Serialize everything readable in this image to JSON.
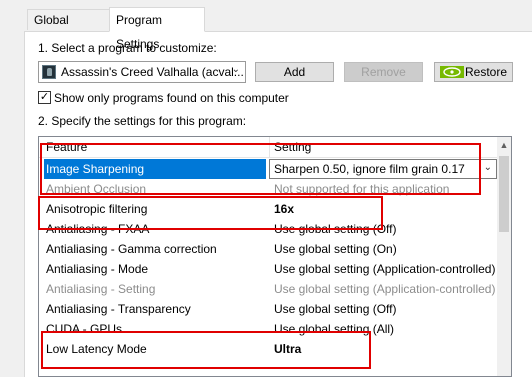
{
  "tabs": [
    {
      "label": "Global Settings"
    },
    {
      "label": "Program Settings"
    }
  ],
  "step1": {
    "label": "1. Select a program to customize:",
    "program_selected": "Assassin's Creed Valhalla (acval...",
    "add_label": "Add",
    "remove_label": "Remove",
    "restore_label": "Restore",
    "show_only_label": "Show only programs found on this computer",
    "show_only_checked": true
  },
  "step2": {
    "label": "2. Specify the settings for this program:",
    "headers": {
      "feature": "Feature",
      "setting": "Setting"
    },
    "rows": [
      {
        "feature": "Image Sharpening",
        "setting": "Sharpen 0.50, ignore film grain 0.17"
      },
      {
        "feature": "Ambient Occlusion",
        "setting": "Not supported for this application"
      },
      {
        "feature": "Anisotropic filtering",
        "setting": "16x"
      },
      {
        "feature": "Antialiasing - FXAA",
        "setting": "Use global setting (Off)"
      },
      {
        "feature": "Antialiasing - Gamma correction",
        "setting": "Use global setting (On)"
      },
      {
        "feature": "Antialiasing - Mode",
        "setting": "Use global setting (Application-controlled)"
      },
      {
        "feature": "Antialiasing - Setting",
        "setting": "Use global setting (Application-controlled)"
      },
      {
        "feature": "Antialiasing - Transparency",
        "setting": "Use global setting (Off)"
      },
      {
        "feature": "CUDA - GPUs",
        "setting": "Use global setting (All)"
      },
      {
        "feature": "Low Latency Mode",
        "setting": "Ultra"
      }
    ]
  },
  "colors": {
    "selection": "#0078d7",
    "highlight_box": "#e00000",
    "nvidia_green": "#76b900"
  }
}
